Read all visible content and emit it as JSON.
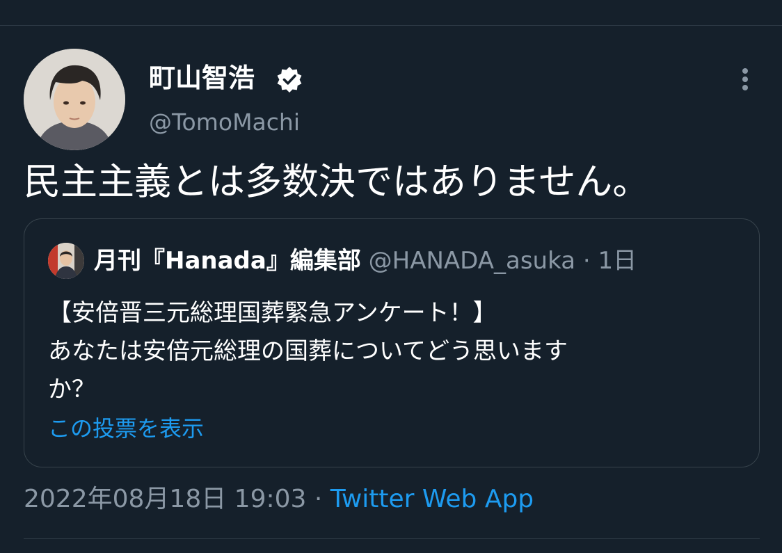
{
  "author": {
    "display_name": "町山智浩",
    "handle": "@TomoMachi",
    "verified_icon": "verified-badge-icon",
    "avatar_icon": "user-avatar"
  },
  "tweet": {
    "text": "民主主義とは多数決ではありません。",
    "timestamp": "2022年08月18日 19:03",
    "separator": "·",
    "source": "Twitter Web App"
  },
  "quoted_tweet": {
    "display_name": "月刊『Hanada』編集部",
    "handle": "@HANADA_asuka",
    "separator": "·",
    "time": "1日",
    "lines": [
      "【安倍晋三元総理国葬緊急アンケート！】",
      "あなたは安倍元総理の国葬についてどう思います",
      "か？"
    ],
    "poll_link": "この投票を表示"
  },
  "colors": {
    "background": "#15202b",
    "text_primary": "#ffffff",
    "text_secondary": "#8b98a5",
    "accent": "#1d9bf0",
    "border": "#38444d"
  }
}
